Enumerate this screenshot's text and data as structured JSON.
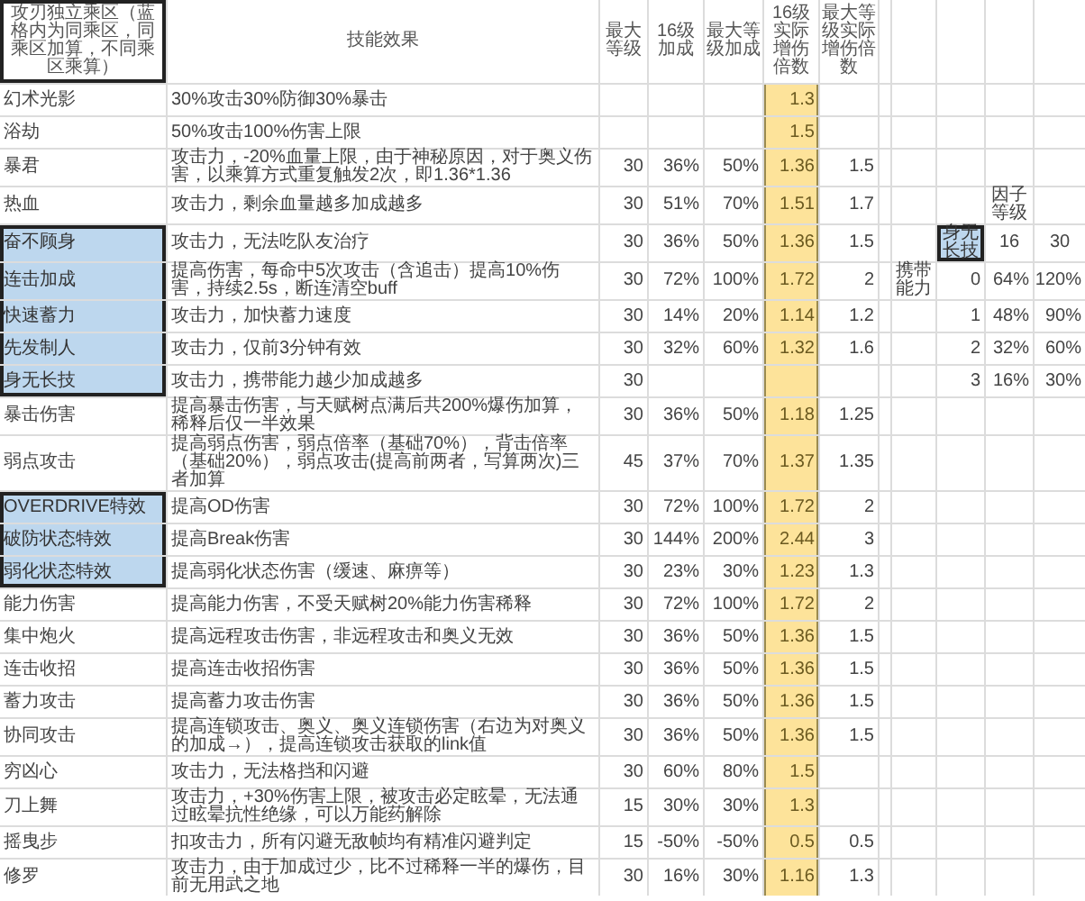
{
  "sheet": {
    "columns": [
      {
        "label": "攻刃独立乘区（蓝格内为同乘区，同乘区加算，不同乘区乘算）",
        "selected": true,
        "highlighted": false
      },
      {
        "label": "技能效果",
        "selected": false,
        "highlighted": false
      },
      {
        "label": "最大等级",
        "selected": false,
        "highlighted": false
      },
      {
        "label": "16级加成",
        "selected": false,
        "highlighted": false
      },
      {
        "label": "最大等级加成",
        "selected": false,
        "highlighted": false
      },
      {
        "label": "16级实际增伤倍数",
        "selected": false,
        "highlighted": true
      },
      {
        "label": "最大等级实际增伤倍数",
        "selected": false,
        "highlighted": false
      }
    ],
    "rows": [
      {
        "name": "幻术光影",
        "effect": "30%攻击30%防御30%暴击",
        "multiplier_16": "1.3",
        "highlighted": false
      },
      {
        "name": "浴劫",
        "effect": "50%攻击100%伤害上限",
        "multiplier_16": "1.5",
        "highlighted": false
      },
      {
        "name": "暴君",
        "effect": "攻击力，-20%血量上限，由于神秘原因，对于奥义伤害，以乘算方式重复触发2次，即1.36*1.36",
        "max_level": "30",
        "bonus_16": "36%",
        "bonus_max": "50%",
        "multiplier_16": "1.36",
        "multiplier_max": "1.5",
        "highlighted": false
      },
      {
        "name": "热血",
        "effect": "攻击力，剩余血量越多加成越多",
        "max_level": "30",
        "bonus_16": "51%",
        "bonus_max": "70%",
        "multiplier_16": "1.51",
        "multiplier_max": "1.7",
        "highlighted": false
      },
      {
        "name": "奋不顾身",
        "effect": "攻击力，无法吃队友治疗",
        "max_level": "30",
        "bonus_16": "36%",
        "bonus_max": "50%",
        "multiplier_16": "1.36",
        "multiplier_max": "1.5",
        "highlighted": true
      },
      {
        "name": "连击加成",
        "effect": "提高伤害，每命中5次攻击（含追击）提高10%伤害，持续2.5s，断连清空buff",
        "max_level": "30",
        "bonus_16": "72%",
        "bonus_max": "100%",
        "multiplier_16": "1.72",
        "multiplier_max": "2",
        "highlighted": true
      },
      {
        "name": "快速蓄力",
        "effect": "攻击力，加快蓄力速度",
        "max_level": "30",
        "bonus_16": "14%",
        "bonus_max": "20%",
        "multiplier_16": "1.14",
        "multiplier_max": "1.2",
        "highlighted": true
      },
      {
        "name": "先发制人",
        "effect": "攻击力，仅前3分钟有效",
        "max_level": "30",
        "bonus_16": "32%",
        "bonus_max": "60%",
        "multiplier_16": "1.32",
        "multiplier_max": "1.6",
        "highlighted": true
      },
      {
        "name": "身无长技",
        "effect": "攻击力，携带能力越少加成越多",
        "max_level": "30",
        "highlighted": true
      },
      {
        "name": "暴击伤害",
        "effect": "提高暴击伤害，与天赋树点满后共200%爆伤加算，稀释后仅一半效果",
        "max_level": "30",
        "bonus_16": "36%",
        "bonus_max": "50%",
        "multiplier_16": "1.18",
        "multiplier_max": "1.25",
        "highlighted": false
      },
      {
        "name": "弱点攻击",
        "effect": "提高弱点伤害，弱点倍率（基础70%），背击倍率（基础20%），弱点攻击(提高前两者，写算两次)三者加算",
        "max_level": "45",
        "bonus_16": "37%",
        "bonus_max": "70%",
        "multiplier_16": "1.37",
        "multiplier_max": "1.35",
        "highlighted": false
      },
      {
        "name": "OVERDRIVE特效",
        "effect": "提高OD伤害",
        "max_level": "30",
        "bonus_16": "72%",
        "bonus_max": "100%",
        "multiplier_16": "1.72",
        "multiplier_max": "2",
        "highlighted": true
      },
      {
        "name": "破防状态特效",
        "effect": "提高Break伤害",
        "max_level": "30",
        "bonus_16": "144%",
        "bonus_max": "200%",
        "multiplier_16": "2.44",
        "multiplier_max": "3",
        "highlighted": true
      },
      {
        "name": "弱化状态特效",
        "effect": "提高弱化状态伤害（缓速、麻痹等）",
        "max_level": "30",
        "bonus_16": "23%",
        "bonus_max": "30%",
        "multiplier_16": "1.23",
        "multiplier_max": "1.3",
        "highlighted": true
      },
      {
        "name": "能力伤害",
        "effect": "提高能力伤害，不受天赋树20%能力伤害稀释",
        "max_level": "30",
        "bonus_16": "72%",
        "bonus_max": "100%",
        "multiplier_16": "1.72",
        "multiplier_max": "2",
        "highlighted": false
      },
      {
        "name": "集中炮火",
        "effect": "提高远程攻击伤害，非远程攻击和奥义无效",
        "max_level": "30",
        "bonus_16": "36%",
        "bonus_max": "50%",
        "multiplier_16": "1.36",
        "multiplier_max": "1.5",
        "highlighted": false
      },
      {
        "name": "连击收招",
        "effect": "提高连击收招伤害",
        "max_level": "30",
        "bonus_16": "36%",
        "bonus_max": "50%",
        "multiplier_16": "1.36",
        "multiplier_max": "1.5",
        "highlighted": false
      },
      {
        "name": "蓄力攻击",
        "effect": "提高蓄力攻击伤害",
        "max_level": "30",
        "bonus_16": "36%",
        "bonus_max": "50%",
        "multiplier_16": "1.36",
        "multiplier_max": "1.5",
        "highlighted": false
      },
      {
        "name": "协同攻击",
        "effect": "提高连锁攻击、奥义、奥义连锁伤害（右边为对奥义的加成→），提高连锁攻击获取的link值",
        "max_level": "30",
        "bonus_16": "36%",
        "bonus_max": "50%",
        "multiplier_16": "1.36",
        "multiplier_max": "1.5",
        "highlighted": false
      },
      {
        "name": "穷凶心",
        "effect": "攻击力，无法格挡和闪避",
        "max_level": "30",
        "bonus_16": "60%",
        "bonus_max": "80%",
        "multiplier_16": "1.5",
        "highlighted": false
      },
      {
        "name": "刀上舞",
        "effect": "攻击力，+30%伤害上限，被攻击必定眩晕，无法通过眩晕抗性绝缘，可以万能药解除",
        "max_level": "15",
        "bonus_16": "30%",
        "bonus_max": "30%",
        "multiplier_16": "1.3",
        "highlighted": false
      },
      {
        "name": "摇曳步",
        "effect": "扣攻击力，所有闪避无敌帧均有精准闪避判定",
        "max_level": "15",
        "bonus_16": "-50%",
        "bonus_max": "-50%",
        "multiplier_16": "0.5",
        "multiplier_max": "0.5",
        "highlighted": false
      },
      {
        "name": "修罗",
        "effect": "攻击力，由于加成过少，比不过稀释一半的爆伤，目前无用武之地",
        "max_level": "30",
        "bonus_16": "16%",
        "bonus_max": "30%",
        "multiplier_16": "1.16",
        "multiplier_max": "1.3",
        "highlighted": false
      }
    ],
    "side_table": {
      "title": "因子等级",
      "skill": {
        "text": "身无长技",
        "highlighted": true
      },
      "levels": [
        "16",
        "30"
      ],
      "label": "携带能力",
      "rows": [
        {
          "count": "0",
          "values": [
            "64%",
            "120%"
          ]
        },
        {
          "count": "1",
          "values": [
            "48%",
            "90%"
          ]
        },
        {
          "count": "2",
          "values": [
            "32%",
            "60%"
          ]
        },
        {
          "count": "3",
          "values": [
            "16%",
            "30%"
          ]
        }
      ]
    }
  }
}
